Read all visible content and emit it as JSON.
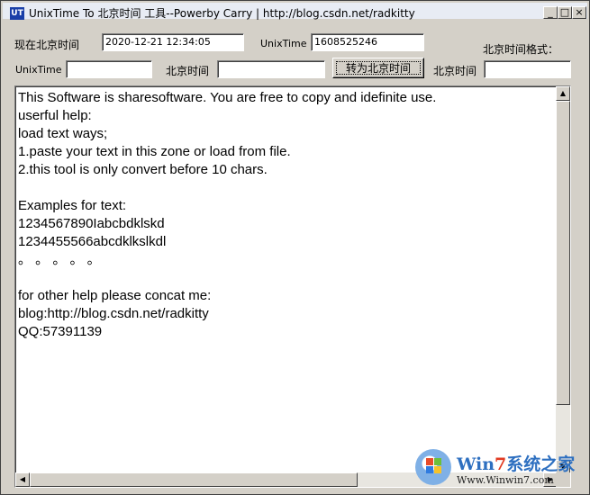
{
  "window": {
    "icon_text": "UT",
    "title": "UnixTime To 北京时间 工具--Powerby Carry |  http://blog.csdn.net/radkitty",
    "controls": {
      "minimize": "_",
      "maximize": "□",
      "close": "×"
    }
  },
  "row1": {
    "beijing_now_label": "现在北京时间",
    "beijing_now_value": "2020-12-21 12:34:05",
    "unixtime_label": "UnixTime",
    "unixtime_value": "1608525246",
    "beijing_format_label": "北京时间格式："
  },
  "row2": {
    "unixtime_label": "UnixTime",
    "unixtime_value": "",
    "beijing_label": "北京时间",
    "beijing_value": "",
    "convert_button": "转为北京时间",
    "beijing_label2": "北京时间",
    "beijing_value2": ""
  },
  "editor": {
    "text": "This Software is sharesoftware. You are free to copy and idefinite use.\nuserful help:\nload text ways;\n1.paste your text in this zone or load from file.\n2.this tool is only convert before 10 chars.\n\nExamples for text:\n1234567890Iabcbdklskd\n1234455566abcdklkslkdl\n。 。 。 。 。\n\nfor other help please concat me:\nblog:http://blog.csdn.net/radkitty\nQQ:57391139"
  },
  "watermark": {
    "brand_prefix": "Win",
    "brand_seven": "7",
    "brand_suffix": "系统之家",
    "url": "Www.Winwin7.com"
  },
  "scroll_icons": {
    "up": "▲",
    "down": "▼",
    "left": "◀",
    "right": "▶"
  }
}
